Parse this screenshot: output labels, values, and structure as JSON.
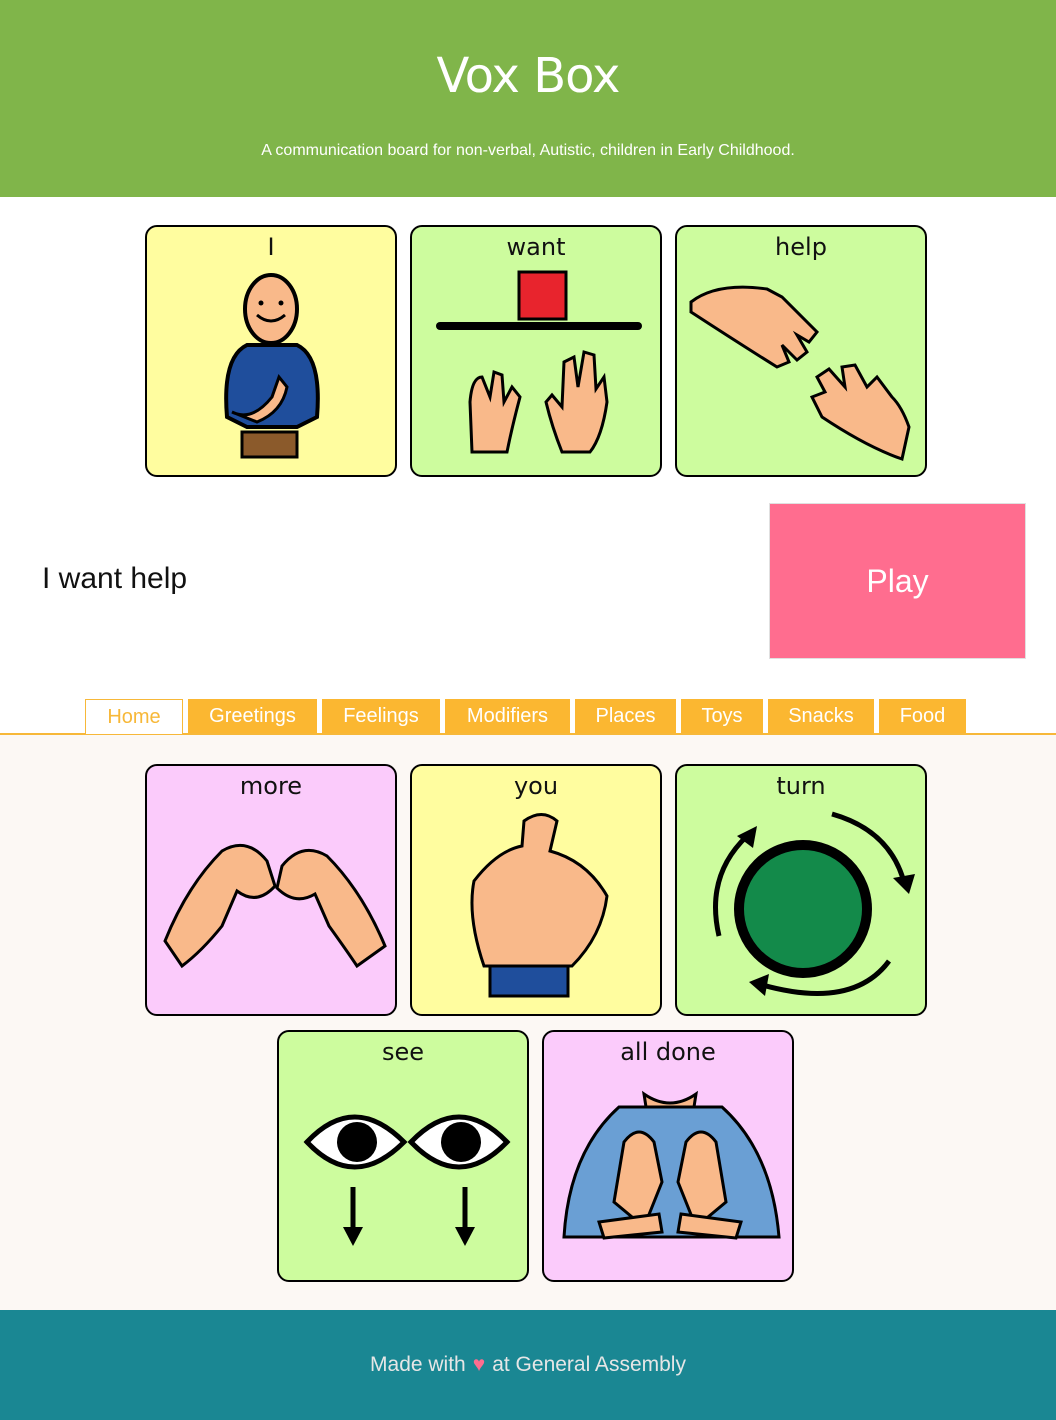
{
  "header": {
    "title": "Vox Box",
    "subtitle": "A communication board for non-verbal, Autistic, children in Early Childhood."
  },
  "sentence_cards": [
    {
      "label": "I",
      "icon": "person-pointing-self-icon",
      "color": "#fffd9f"
    },
    {
      "label": "want",
      "icon": "want-hands-icon",
      "color": "#cdfc9e"
    },
    {
      "label": "help",
      "icon": "helping-hands-icon",
      "color": "#cdfc9e"
    }
  ],
  "sentence": {
    "text": "I want help",
    "play_label": "Play"
  },
  "tabs": [
    {
      "label": "Home",
      "active": true
    },
    {
      "label": "Greetings",
      "active": false
    },
    {
      "label": "Feelings",
      "active": false
    },
    {
      "label": "Modifiers",
      "active": false
    },
    {
      "label": "Places",
      "active": false
    },
    {
      "label": "Toys",
      "active": false
    },
    {
      "label": "Snacks",
      "active": false
    },
    {
      "label": "Food",
      "active": false
    }
  ],
  "board_cards": [
    {
      "label": "more",
      "icon": "more-sign-hands-icon",
      "color": "#fbcbfb"
    },
    {
      "label": "you",
      "icon": "pointing-finger-icon",
      "color": "#fffd9f"
    },
    {
      "label": "turn",
      "icon": "turn-circle-icon",
      "color": "#cdfc9e"
    },
    {
      "label": "see",
      "icon": "eyes-looking-icon",
      "color": "#cdfc9e"
    },
    {
      "label": "all done",
      "icon": "all-done-sign-icon",
      "color": "#fbcbfb"
    }
  ],
  "footer": {
    "before": "Made with",
    "heart": "♥",
    "after": "at General Assembly"
  },
  "colors": {
    "header": "#80b54a",
    "play": "#ff6d8f",
    "tab": "#fbb731",
    "footer": "#1a8793"
  }
}
